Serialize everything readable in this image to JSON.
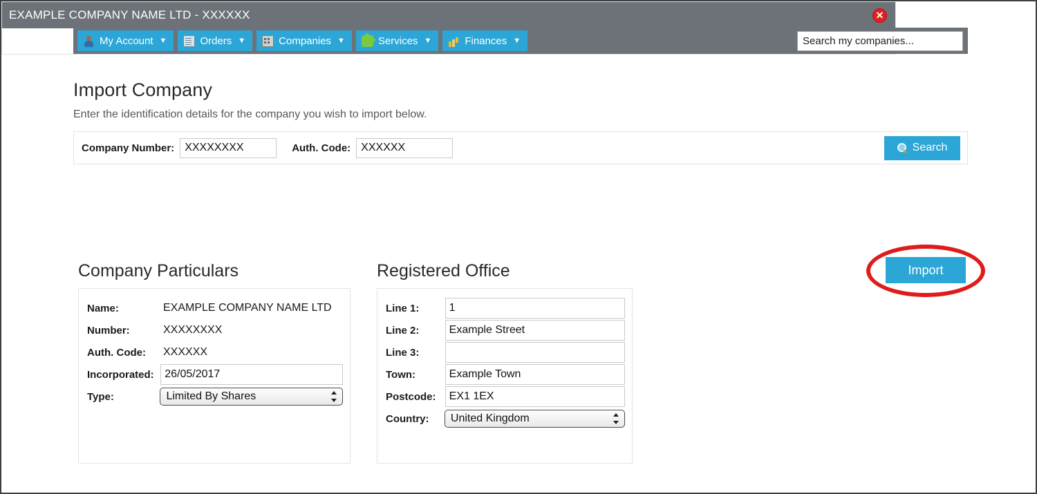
{
  "nav": {
    "items": [
      {
        "label": "My Account",
        "icon": "avatar-icon",
        "caret": "▼"
      },
      {
        "label": "Orders",
        "icon": "document-icon",
        "caret": "▼"
      },
      {
        "label": "Companies",
        "icon": "building-icon",
        "caret": "▼"
      },
      {
        "label": "Services",
        "icon": "puzzle-piece-icon",
        "caret": "▼"
      },
      {
        "label": "Finances",
        "icon": "bar-chart-coins-icon",
        "caret": "▼"
      }
    ],
    "search": {
      "placeholder": "Search my companies...",
      "value": ""
    }
  },
  "header": {
    "title": "Import Company",
    "subtitle": "Enter the identification details for the company you wish to import below."
  },
  "search_panel": {
    "company_number_label": "Company Number:",
    "company_number_value": "XXXXXXXX",
    "auth_code_label": "Auth. Code:",
    "auth_code_value": "XXXXXX",
    "search_button": "Search"
  },
  "result": {
    "title": "EXAMPLE COMPANY NAME LTD - XXXXXX",
    "close_label": "✕"
  },
  "particulars": {
    "title": "Company Particulars",
    "rows": [
      {
        "label": "Name:",
        "value": "EXAMPLE COMPANY NAME LTD"
      },
      {
        "label": "Number:",
        "value": "XXXXXXXX"
      },
      {
        "label": "Auth. Code:",
        "value": "XXXXXX"
      }
    ],
    "incorporated_label": "Incorporated:",
    "incorporated_value": "26/05/2017",
    "type_label": "Type:",
    "type_value": "Limited By Shares"
  },
  "office": {
    "title": "Registered Office",
    "rows": [
      {
        "label": "Line 1:",
        "value": "1"
      },
      {
        "label": "Line 2:",
        "value": "Example Street"
      },
      {
        "label": "Line 3:",
        "value": ""
      },
      {
        "label": "Town:",
        "value": "Example Town"
      },
      {
        "label": "Postcode:",
        "value": "EX1 1EX"
      }
    ],
    "country_label": "Country:",
    "country_value": "United Kingdom"
  },
  "actions": {
    "import_button": "Import"
  },
  "colors": {
    "accent_blue": "#2ba6d6",
    "bar_grey": "#6d7278",
    "close_red": "#e02020",
    "annotation_red": "#e01b1b"
  }
}
